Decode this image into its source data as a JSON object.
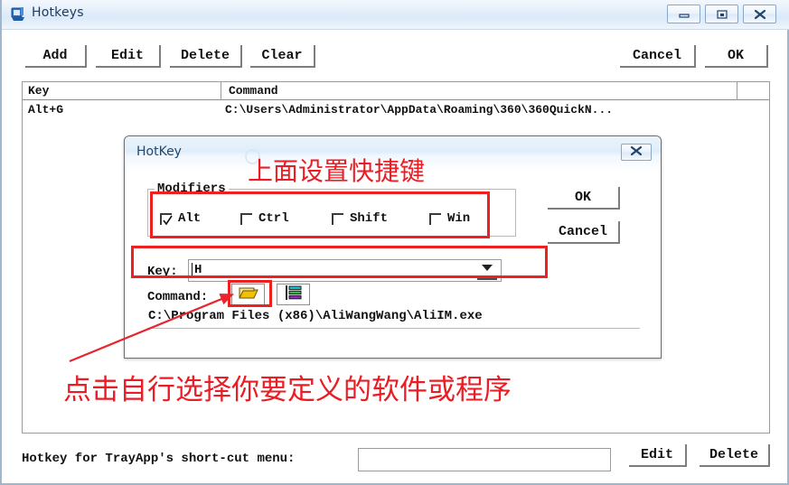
{
  "window": {
    "title": "Hotkeys",
    "icon": "hotkeys-app-icon",
    "controls": {
      "minimize": "minimize-icon",
      "maximize": "maximize-icon",
      "close": "close-icon"
    }
  },
  "toolbar": {
    "add_label": "Add",
    "edit_label": "Edit",
    "delete_label": "Delete",
    "clear_label": "Clear",
    "cancel_label": "Cancel",
    "ok_label": "OK"
  },
  "list": {
    "columns": [
      "Key",
      "Command"
    ],
    "rows": [
      {
        "key": "Alt+G",
        "command": "C:\\Users\\Administrator\\AppData\\Roaming\\360\\360QuickN..."
      }
    ]
  },
  "bottom_bar": {
    "label": "Hotkey for TrayApp's short-cut menu:",
    "input_value": "",
    "input_placeholder": "",
    "edit_label": "Edit",
    "delete_label": "Delete"
  },
  "hotkey_dialog": {
    "title": "HotKey",
    "close_icon": "close-icon",
    "modifiers_legend": "Modifiers",
    "modifiers": [
      {
        "label": "Alt",
        "checked": true
      },
      {
        "label": "Ctrl",
        "checked": false
      },
      {
        "label": "Shift",
        "checked": false
      },
      {
        "label": "Win",
        "checked": false
      }
    ],
    "key_label": "Key:",
    "key_value": "H",
    "key_dropdown_icon": "chevron-down-icon",
    "command_label": "Command:",
    "browse_icon": "open-folder-icon",
    "properties_icon": "properties-list-icon",
    "command_path": "C:\\Program Files (x86)\\AliWangWang\\AliIM.exe",
    "ok_label": "OK",
    "cancel_label": "Cancel"
  },
  "annotations": {
    "top_note": "上面设置快捷键",
    "bottom_note": "点击自行选择你要定义的软件或程序",
    "highlight_color": "#ef2020",
    "note_color": "#ea1c24"
  }
}
